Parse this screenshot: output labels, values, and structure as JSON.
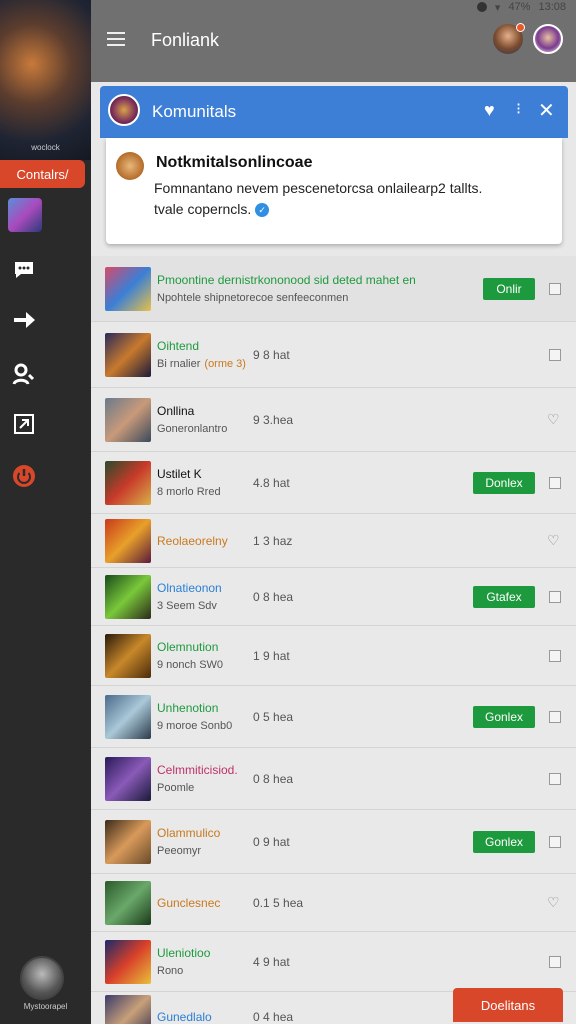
{
  "status_bar": {
    "battery": "47%",
    "time": "13:08"
  },
  "sidebar": {
    "art_caption": "woclock",
    "contacts_label": "Contalrs/",
    "footer_label": "Mystoorapel"
  },
  "topbar": {
    "title": "Fonliank"
  },
  "notification": {
    "header_title": "Komunitals",
    "title": "Notkmitalsonlincoae",
    "text_line1": "Fomnantano nevem pescenetorcsa onlailearp2 tallts.",
    "text_line2": "tvale coperncls."
  },
  "rows": [
    {
      "title": "Pmoontine dernistrkononood sid deted mahet en",
      "title_color": "#1e9a3e",
      "sub": "Npohtele shipnetorecoe senfeeconmen",
      "time": "",
      "button": "Onlir",
      "end": "check"
    },
    {
      "title": "Oihtend",
      "title_color": "#1e9a3e",
      "sub": "Bi rnalier",
      "sub_tag": "(orme 3)",
      "time": "9 8 hat",
      "button": "",
      "end": "check"
    },
    {
      "title": "Onllina",
      "title_color": "#111111",
      "sub": "Goneronlantro",
      "time": "9 3.hea",
      "button": "",
      "end": "heart"
    },
    {
      "title": "Ustilet K",
      "title_color": "#111111",
      "sub": "8 morlo Rred",
      "time": "4.8 hat",
      "button": "Donlex",
      "end": "check"
    },
    {
      "title": "Reolaeorelny",
      "title_color": "#c87a1e",
      "sub": "",
      "time": "1 3 haz",
      "button": "",
      "end": "heart"
    },
    {
      "title": "Olnatieonon",
      "title_color": "#2a7fd6",
      "sub": "3 Seem Sdv",
      "time": "0 8 hea",
      "button": "Gtafex",
      "end": "check"
    },
    {
      "title": "Olemnution",
      "title_color": "#1e9a3e",
      "sub": "9 nonch SW0",
      "time": "1 9 hat",
      "button": "",
      "end": "check"
    },
    {
      "title": "Unhenotion",
      "title_color": "#1e9a3e",
      "sub": "9 moroe Sonb0",
      "time": "0 5 hea",
      "button": "Gonlex",
      "end": "check"
    },
    {
      "title": "Celmmiticisiod.",
      "title_color": "#c0306a",
      "sub": "Poomle",
      "time": "0 8 hea",
      "button": "",
      "end": "check"
    },
    {
      "title": "Olammulico",
      "title_color": "#c87a1e",
      "sub": "Peeomyr",
      "time": "0 9 hat",
      "button": "Gonlex",
      "end": "check"
    },
    {
      "title": "Gunclesnec",
      "title_color": "#c87a1e",
      "sub": "",
      "time": "0.1 5 hea",
      "button": "",
      "end": "heart"
    },
    {
      "title": "Uleniotioo",
      "title_color": "#1e9a3e",
      "sub": "Rono",
      "time": "4 9 hat",
      "button": "",
      "end": "check"
    },
    {
      "title": "Gunedlalo",
      "title_color": "#2a7fd6",
      "sub": "",
      "time": "0 4 hea",
      "button": "",
      "end": ""
    }
  ],
  "fab_label": "Doelitans"
}
